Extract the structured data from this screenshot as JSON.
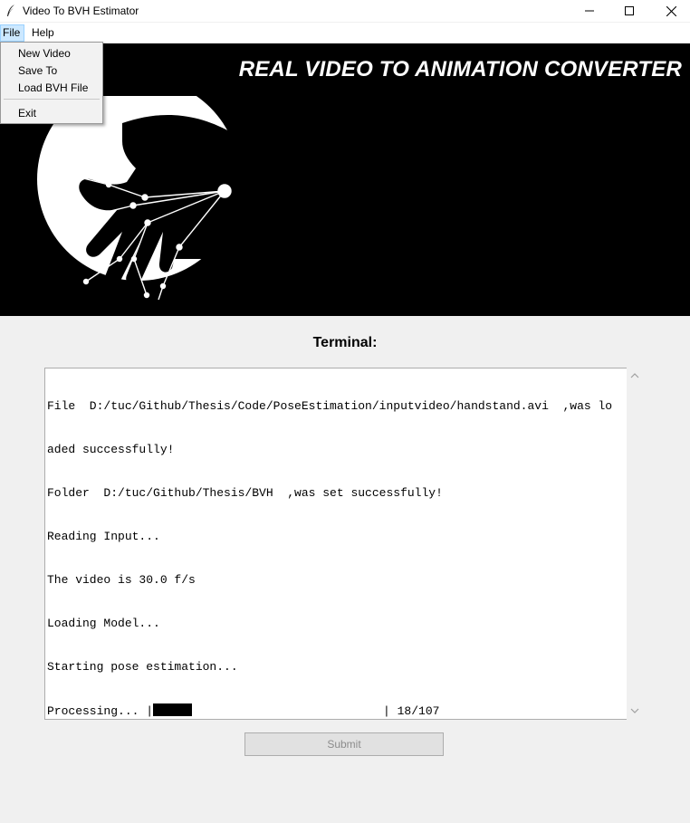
{
  "window": {
    "title": "Video To BVH Estimator",
    "icons": [
      "feather-icon",
      "minimize-icon",
      "maximize-icon",
      "close-icon"
    ]
  },
  "menubar": {
    "file": "File",
    "help": "Help"
  },
  "file_menu": {
    "items": [
      "New Video",
      "Save To",
      "Load BVH File",
      "Exit"
    ]
  },
  "banner": {
    "title": "REAL VIDEO TO ANIMATION CONVERTER",
    "logo_icon": "hand-skeleton-logo"
  },
  "terminal": {
    "label": "Terminal:",
    "lines": [
      "File  D:/tuc/Github/Thesis/Code/PoseEstimation/inputvideo/handstand.avi  ,was lo",
      "aded successfully!",
      "Folder  D:/tuc/Github/Thesis/BVH  ,was set successfully!",
      "Reading Input...",
      "The video is 30.0 f/s",
      "Loading Model...",
      "Starting pose estimation..."
    ],
    "progress": {
      "prefix": "Processing... |",
      "suffix": "| 18/107",
      "fraction": 0.168
    }
  },
  "submit": {
    "label": "Submit",
    "enabled": false
  },
  "colors": {
    "banner_bg": "#000000",
    "window_bg": "#f0f0f0",
    "menu_highlight": "#cce8ff"
  }
}
